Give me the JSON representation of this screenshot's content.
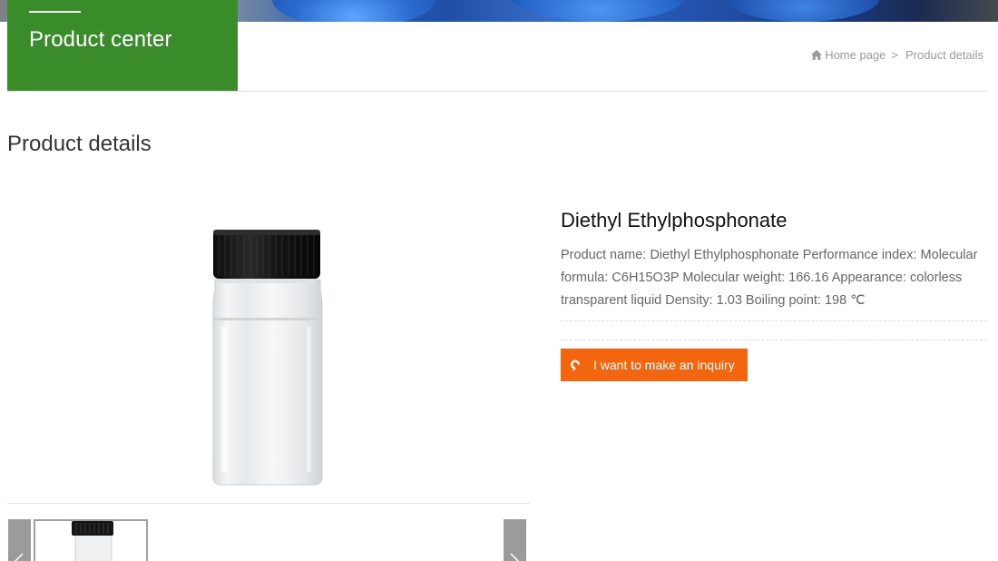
{
  "header": {
    "category_title": "Product center"
  },
  "breadcrumb": {
    "home_icon": "home-icon",
    "home_label": "Home page",
    "separator": ">",
    "current_label": "Product details"
  },
  "page_title": "Product details",
  "product": {
    "name": "Diethyl Ethylphosphonate",
    "description": "Product name: Diethyl Ethylphosphonate Performance index: Molecular formula: C6H15O3P Molecular weight: 166.16 Appearance: colorless transparent liquid Density: 1.03 Boiling point: 198 ℃",
    "inquiry_label": "I want to make an inquiry",
    "inquiry_icon": "chat-bubble-icon"
  },
  "gallery": {
    "prev_icon": "chevron-left-icon",
    "next_icon": "chevron-right-icon"
  },
  "colors": {
    "category_green": "#3a8b2a",
    "inquiry_orange": "#f3650e",
    "muted_text": "#9a9a9a"
  }
}
